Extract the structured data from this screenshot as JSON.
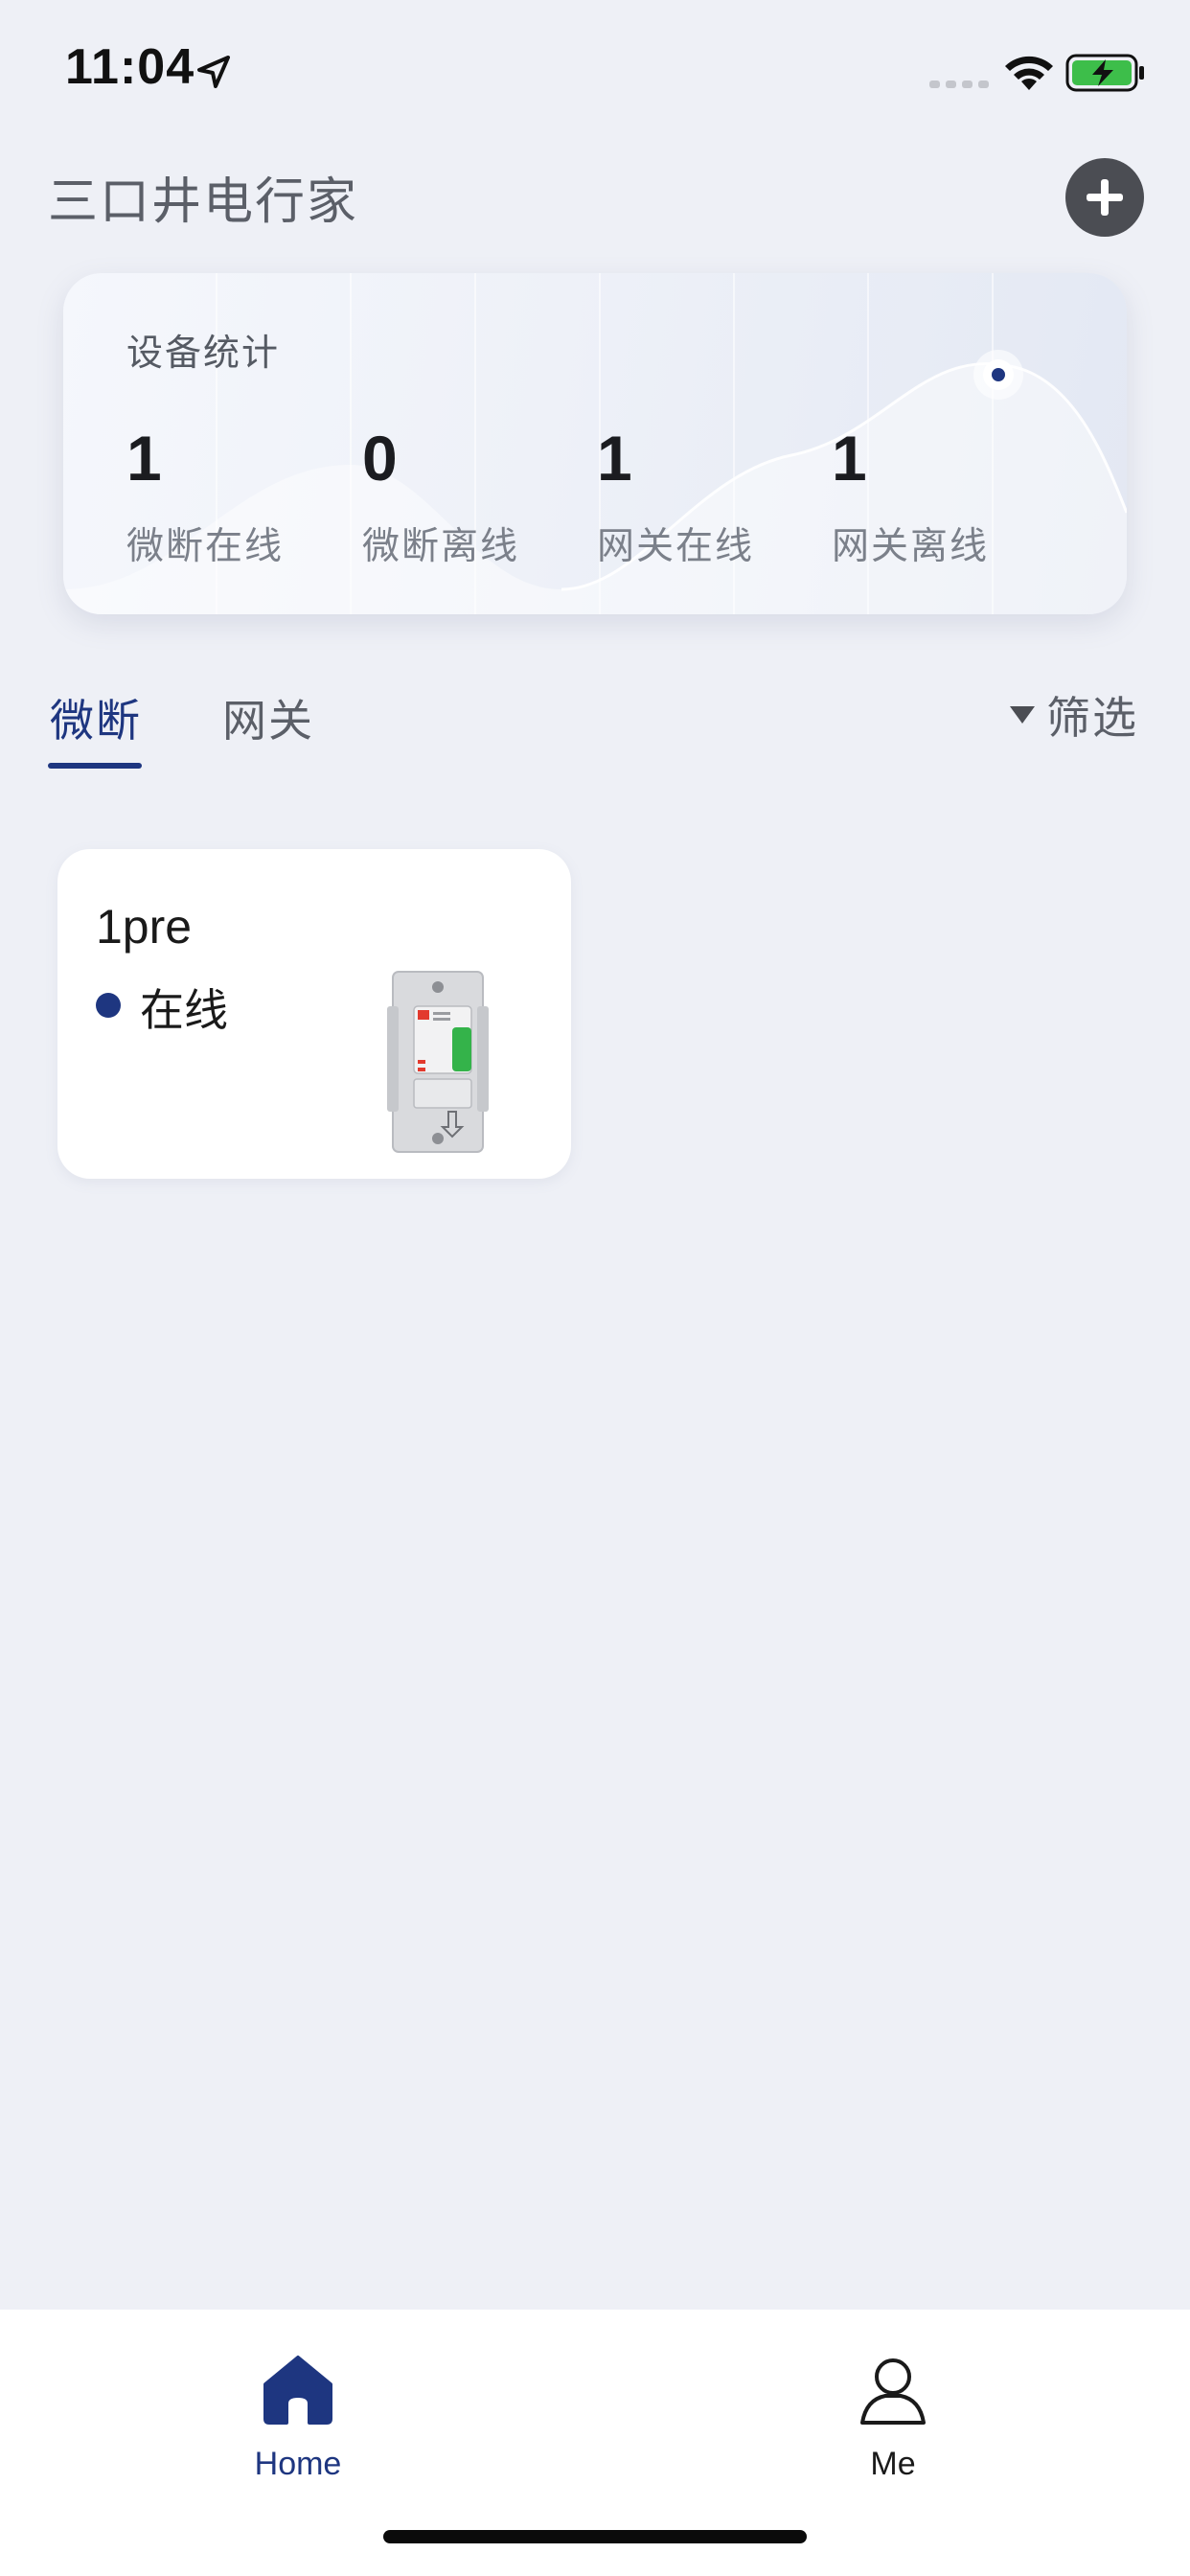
{
  "status_bar": {
    "time": "11:04"
  },
  "header": {
    "title": "三口井电行家"
  },
  "stats": {
    "title": "设备统计",
    "items": [
      {
        "value": "1",
        "label": "微断在线"
      },
      {
        "value": "0",
        "label": "微断离线"
      },
      {
        "value": "1",
        "label": "网关在线"
      },
      {
        "value": "1",
        "label": "网关离线"
      }
    ]
  },
  "tabs": [
    {
      "label": "微断",
      "active": true
    },
    {
      "label": "网关",
      "active": false
    }
  ],
  "filter": {
    "label": "筛选"
  },
  "devices": [
    {
      "name": "1pre",
      "status": "在线",
      "status_color": "#1e3680"
    }
  ],
  "bottom_nav": {
    "items": [
      {
        "label": "Home",
        "icon": "home-icon",
        "active": true
      },
      {
        "label": "Me",
        "icon": "person-icon",
        "active": false
      }
    ]
  },
  "colors": {
    "accent": "#1e3680",
    "background": "#eef0f6",
    "add_button": "#4b4d53"
  }
}
